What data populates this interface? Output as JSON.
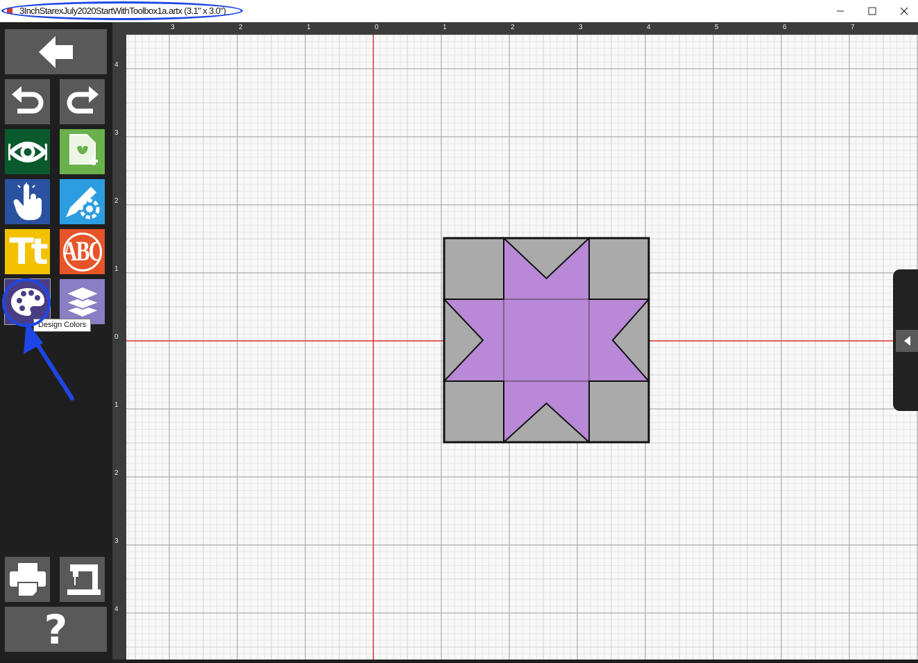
{
  "window": {
    "title": "3InchStarexJuly2020StartWithToolbox1a.artx (3.1\" x 3.0\")",
    "controls": {
      "minimize": "minimize-icon",
      "maximize": "maximize-icon",
      "close": "close-icon"
    }
  },
  "sidebar": {
    "tools": [
      {
        "id": "back",
        "icon": "back-arrow-icon",
        "color": "#595959"
      },
      {
        "id": "undo",
        "icon": "undo-icon",
        "color": "#595959"
      },
      {
        "id": "redo",
        "icon": "redo-icon",
        "color": "#595959"
      },
      {
        "id": "view",
        "icon": "eye-icon",
        "color": "#0a5a2e"
      },
      {
        "id": "add-design",
        "icon": "add-design-icon",
        "color": "#6ab04c"
      },
      {
        "id": "select",
        "icon": "touch-hand-icon",
        "color": "#2a52a0"
      },
      {
        "id": "edit-settings",
        "icon": "pencil-gear-icon",
        "color": "#2c9de0"
      },
      {
        "id": "text",
        "icon": "text-tt-icon",
        "color": "#f2c200"
      },
      {
        "id": "monogram",
        "icon": "monogram-abc-icon",
        "color": "#e8542a"
      },
      {
        "id": "design-colors",
        "icon": "palette-icon",
        "color": "#4a3d86"
      },
      {
        "id": "layers",
        "icon": "layers-icon",
        "color": "#8a7ec4"
      },
      {
        "id": "print",
        "icon": "printer-icon",
        "color": "#595959"
      },
      {
        "id": "send-to-machine",
        "icon": "sewing-machine-icon",
        "color": "#595959"
      },
      {
        "id": "help",
        "icon": "help-icon",
        "color": "#595959"
      }
    ],
    "text_tool_label": "Tt",
    "monogram_label": "ABC",
    "help_label": "?"
  },
  "tooltip": {
    "text": "Design Colors"
  },
  "ruler": {
    "top_labels": [
      "3",
      "2",
      "1",
      "0",
      "1",
      "2",
      "3",
      "4",
      "5",
      "6",
      "7"
    ],
    "left_labels": [
      "4",
      "3",
      "2",
      "1",
      "0",
      "1",
      "2",
      "3",
      "4"
    ]
  },
  "design": {
    "fill_star": "#b988d6",
    "fill_background": "#aaaaaa",
    "outline": "#111111"
  },
  "colors": {
    "axis": "#e03030",
    "annotation": "#1e46e6"
  }
}
